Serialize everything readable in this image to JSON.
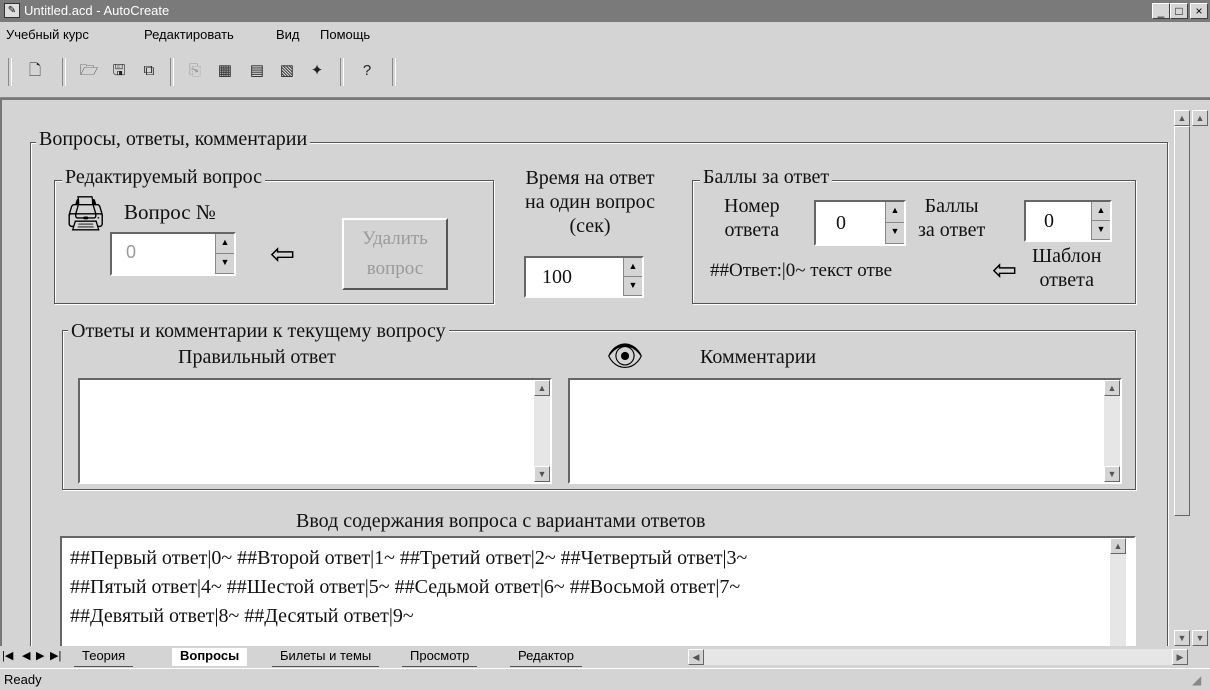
{
  "window": {
    "title": "Untitled.acd - AutoCreate",
    "min": "_",
    "max": "□",
    "close": "×"
  },
  "menu": {
    "items": [
      "Учебный курс",
      "Редактировать",
      "Вид",
      "Помощь"
    ]
  },
  "toolbar": {
    "icons": [
      "new-icon",
      "open-icon",
      "save-icon",
      "save-as-icon",
      "copy-icon",
      "image-icon",
      "image-list-icon",
      "image-edit-icon",
      "wizard-icon",
      "help-icon"
    ]
  },
  "section": {
    "title": "Вопросы, ответы, комментарии",
    "edit_group": {
      "label": "Редактируемый вопрос",
      "question_no_label": "Вопрос №",
      "question_no_value": "0",
      "delete_button": [
        "Удалить",
        "вопрос"
      ]
    },
    "time": {
      "line1": "Время на ответ",
      "line2": "на один вопрос",
      "line3": "(сек)",
      "value": "100"
    },
    "score_group": {
      "label": "Баллы за ответ",
      "answer_no_label": [
        "Номер",
        "ответа"
      ],
      "answer_no_value": "0",
      "score_label": [
        "Баллы",
        "за ответ"
      ],
      "score_value": "0",
      "template_text": "##Ответ:|0~ текст отве",
      "template_label": [
        "Шаблон",
        "ответа"
      ]
    },
    "answers_group": {
      "label": "Ответы и комментарии к текущему вопросу",
      "correct_label": "Правильный ответ",
      "comments_label": "Комментарии"
    },
    "input": {
      "label": "Ввод содержания вопроса с вариантами ответов",
      "lines": [
        "##Первый ответ|0~  ##Второй ответ|1~  ##Третий ответ|2~  ##Четвертый ответ|3~",
        "##Пятый ответ|4~  ##Шестой ответ|5~  ##Седьмой ответ|6~  ##Восьмой ответ|7~",
        "##Девятый ответ|8~  ##Десятый ответ|9~"
      ]
    }
  },
  "tabs": {
    "items": [
      "Теория",
      "Вопросы",
      "Билеты и темы",
      "Просмотр",
      "Редактор"
    ],
    "active": "Вопросы"
  },
  "status": {
    "text": "Ready"
  }
}
